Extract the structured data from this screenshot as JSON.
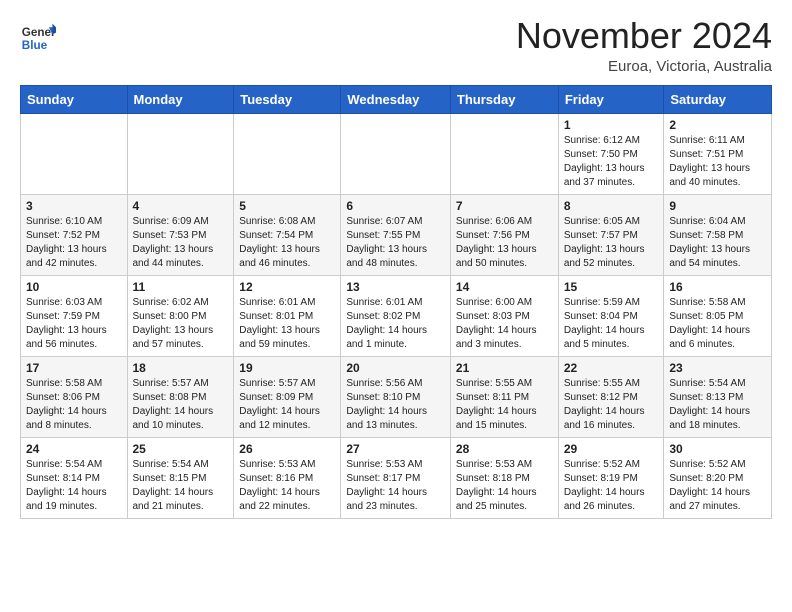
{
  "logo": {
    "general": "General",
    "blue": "Blue"
  },
  "title": "November 2024",
  "location": "Euroa, Victoria, Australia",
  "weekdays": [
    "Sunday",
    "Monday",
    "Tuesday",
    "Wednesday",
    "Thursday",
    "Friday",
    "Saturday"
  ],
  "weeks": [
    [
      {
        "day": "",
        "info": ""
      },
      {
        "day": "",
        "info": ""
      },
      {
        "day": "",
        "info": ""
      },
      {
        "day": "",
        "info": ""
      },
      {
        "day": "",
        "info": ""
      },
      {
        "day": "1",
        "info": "Sunrise: 6:12 AM\nSunset: 7:50 PM\nDaylight: 13 hours\nand 37 minutes."
      },
      {
        "day": "2",
        "info": "Sunrise: 6:11 AM\nSunset: 7:51 PM\nDaylight: 13 hours\nand 40 minutes."
      }
    ],
    [
      {
        "day": "3",
        "info": "Sunrise: 6:10 AM\nSunset: 7:52 PM\nDaylight: 13 hours\nand 42 minutes."
      },
      {
        "day": "4",
        "info": "Sunrise: 6:09 AM\nSunset: 7:53 PM\nDaylight: 13 hours\nand 44 minutes."
      },
      {
        "day": "5",
        "info": "Sunrise: 6:08 AM\nSunset: 7:54 PM\nDaylight: 13 hours\nand 46 minutes."
      },
      {
        "day": "6",
        "info": "Sunrise: 6:07 AM\nSunset: 7:55 PM\nDaylight: 13 hours\nand 48 minutes."
      },
      {
        "day": "7",
        "info": "Sunrise: 6:06 AM\nSunset: 7:56 PM\nDaylight: 13 hours\nand 50 minutes."
      },
      {
        "day": "8",
        "info": "Sunrise: 6:05 AM\nSunset: 7:57 PM\nDaylight: 13 hours\nand 52 minutes."
      },
      {
        "day": "9",
        "info": "Sunrise: 6:04 AM\nSunset: 7:58 PM\nDaylight: 13 hours\nand 54 minutes."
      }
    ],
    [
      {
        "day": "10",
        "info": "Sunrise: 6:03 AM\nSunset: 7:59 PM\nDaylight: 13 hours\nand 56 minutes."
      },
      {
        "day": "11",
        "info": "Sunrise: 6:02 AM\nSunset: 8:00 PM\nDaylight: 13 hours\nand 57 minutes."
      },
      {
        "day": "12",
        "info": "Sunrise: 6:01 AM\nSunset: 8:01 PM\nDaylight: 13 hours\nand 59 minutes."
      },
      {
        "day": "13",
        "info": "Sunrise: 6:01 AM\nSunset: 8:02 PM\nDaylight: 14 hours\nand 1 minute."
      },
      {
        "day": "14",
        "info": "Sunrise: 6:00 AM\nSunset: 8:03 PM\nDaylight: 14 hours\nand 3 minutes."
      },
      {
        "day": "15",
        "info": "Sunrise: 5:59 AM\nSunset: 8:04 PM\nDaylight: 14 hours\nand 5 minutes."
      },
      {
        "day": "16",
        "info": "Sunrise: 5:58 AM\nSunset: 8:05 PM\nDaylight: 14 hours\nand 6 minutes."
      }
    ],
    [
      {
        "day": "17",
        "info": "Sunrise: 5:58 AM\nSunset: 8:06 PM\nDaylight: 14 hours\nand 8 minutes."
      },
      {
        "day": "18",
        "info": "Sunrise: 5:57 AM\nSunset: 8:08 PM\nDaylight: 14 hours\nand 10 minutes."
      },
      {
        "day": "19",
        "info": "Sunrise: 5:57 AM\nSunset: 8:09 PM\nDaylight: 14 hours\nand 12 minutes."
      },
      {
        "day": "20",
        "info": "Sunrise: 5:56 AM\nSunset: 8:10 PM\nDaylight: 14 hours\nand 13 minutes."
      },
      {
        "day": "21",
        "info": "Sunrise: 5:55 AM\nSunset: 8:11 PM\nDaylight: 14 hours\nand 15 minutes."
      },
      {
        "day": "22",
        "info": "Sunrise: 5:55 AM\nSunset: 8:12 PM\nDaylight: 14 hours\nand 16 minutes."
      },
      {
        "day": "23",
        "info": "Sunrise: 5:54 AM\nSunset: 8:13 PM\nDaylight: 14 hours\nand 18 minutes."
      }
    ],
    [
      {
        "day": "24",
        "info": "Sunrise: 5:54 AM\nSunset: 8:14 PM\nDaylight: 14 hours\nand 19 minutes."
      },
      {
        "day": "25",
        "info": "Sunrise: 5:54 AM\nSunset: 8:15 PM\nDaylight: 14 hours\nand 21 minutes."
      },
      {
        "day": "26",
        "info": "Sunrise: 5:53 AM\nSunset: 8:16 PM\nDaylight: 14 hours\nand 22 minutes."
      },
      {
        "day": "27",
        "info": "Sunrise: 5:53 AM\nSunset: 8:17 PM\nDaylight: 14 hours\nand 23 minutes."
      },
      {
        "day": "28",
        "info": "Sunrise: 5:53 AM\nSunset: 8:18 PM\nDaylight: 14 hours\nand 25 minutes."
      },
      {
        "day": "29",
        "info": "Sunrise: 5:52 AM\nSunset: 8:19 PM\nDaylight: 14 hours\nand 26 minutes."
      },
      {
        "day": "30",
        "info": "Sunrise: 5:52 AM\nSunset: 8:20 PM\nDaylight: 14 hours\nand 27 minutes."
      }
    ]
  ]
}
